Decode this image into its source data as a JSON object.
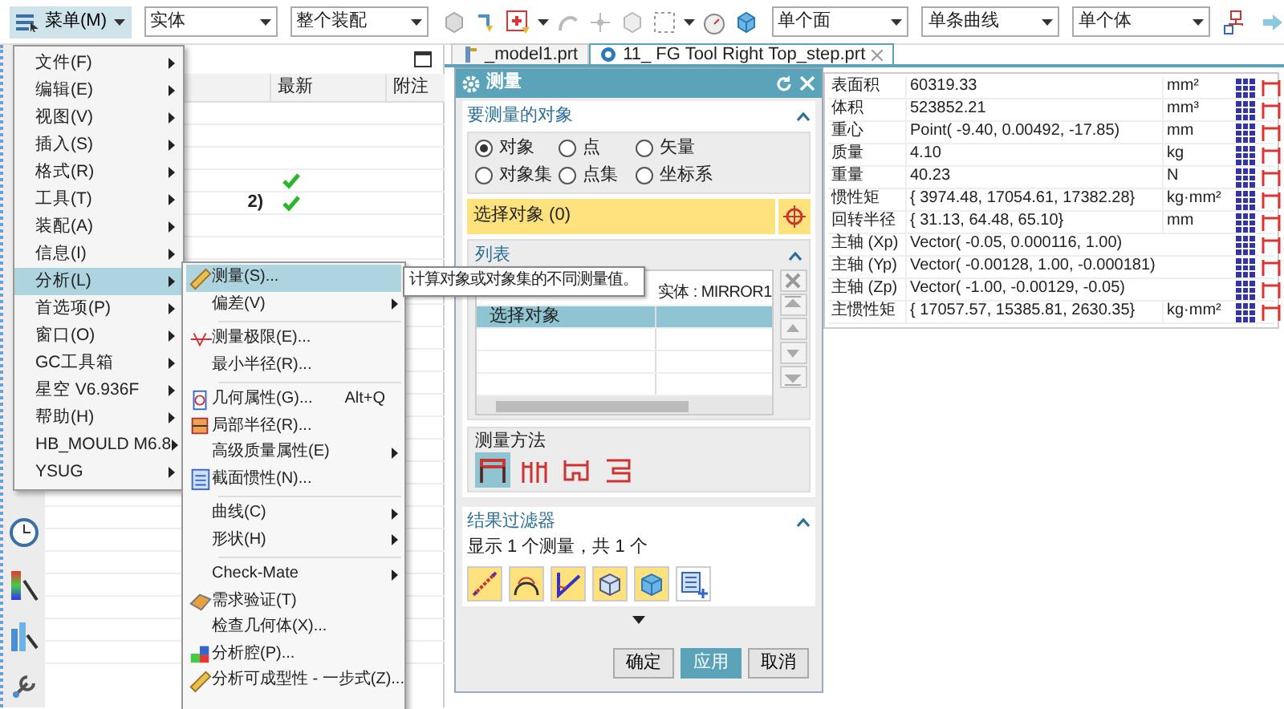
{
  "toolbar": {
    "menu_button": "菜单(M)",
    "selectors": [
      {
        "value": "实体"
      },
      {
        "value": "整个装配"
      },
      {
        "value": "单个面"
      },
      {
        "value": "单条曲线"
      },
      {
        "value": "单个体"
      }
    ]
  },
  "tabs": [
    {
      "label": "_model1.prt",
      "selected": false
    },
    {
      "label": "11_ FG Tool Right Top_step.prt",
      "selected": true
    }
  ],
  "part_navigator": {
    "columns": [
      "最新",
      "附注"
    ],
    "rows": [
      {
        "latest": true
      },
      {
        "name": "2)",
        "latest": true
      }
    ]
  },
  "main_menu": [
    {
      "label": "文件(F)",
      "submenu": true,
      "selected": false
    },
    {
      "label": "编辑(E)",
      "submenu": true,
      "selected": false
    },
    {
      "label": "视图(V)",
      "submenu": true,
      "selected": false
    },
    {
      "label": "插入(S)",
      "submenu": true,
      "selected": false
    },
    {
      "label": "格式(R)",
      "submenu": true,
      "selected": false
    },
    {
      "label": "工具(T)",
      "submenu": true,
      "selected": false
    },
    {
      "label": "装配(A)",
      "submenu": true,
      "selected": false
    },
    {
      "label": "信息(I)",
      "submenu": true,
      "selected": false
    },
    {
      "label": "分析(L)",
      "submenu": true,
      "selected": true
    },
    {
      "label": "首选项(P)",
      "submenu": true,
      "selected": false
    },
    {
      "label": "窗口(O)",
      "submenu": true,
      "selected": false
    },
    {
      "label": "GC工具箱",
      "submenu": true,
      "selected": false
    },
    {
      "label": "星空 V6.936F",
      "submenu": true,
      "selected": false
    },
    {
      "label": "帮助(H)",
      "submenu": true,
      "selected": false
    },
    {
      "label": "HB_MOULD M6.8",
      "submenu": true,
      "selected": false
    },
    {
      "label": "YSUG",
      "submenu": true,
      "selected": false
    }
  ],
  "analysis_menu": [
    {
      "kind": "item",
      "label": "测量(S)...",
      "icon": true,
      "submenu": false,
      "selected": true
    },
    {
      "kind": "item",
      "label": "偏差(V)",
      "icon": false,
      "submenu": true,
      "selected": false
    },
    {
      "kind": "separator"
    },
    {
      "kind": "item",
      "label": "测量极限(E)...",
      "icon": true,
      "submenu": false,
      "selected": false
    },
    {
      "kind": "item",
      "label": "最小半径(R)...",
      "icon": false,
      "submenu": false,
      "selected": false
    },
    {
      "kind": "separator"
    },
    {
      "kind": "item",
      "label": "几何属性(G)...",
      "shortcut": "Alt+Q",
      "icon": true,
      "submenu": false,
      "selected": false
    },
    {
      "kind": "item",
      "label": "局部半径(R)...",
      "icon": true,
      "submenu": false,
      "selected": false
    },
    {
      "kind": "item",
      "label": "高级质量属性(E)",
      "icon": false,
      "submenu": true,
      "selected": false
    },
    {
      "kind": "item",
      "label": "截面惯性(N)...",
      "icon": true,
      "submenu": false,
      "selected": false
    },
    {
      "kind": "separator"
    },
    {
      "kind": "item",
      "label": "曲线(C)",
      "icon": false,
      "submenu": true,
      "selected": false
    },
    {
      "kind": "item",
      "label": "形状(H)",
      "icon": false,
      "submenu": true,
      "selected": false
    },
    {
      "kind": "separator"
    },
    {
      "kind": "item",
      "label": "Check-Mate",
      "icon": false,
      "submenu": true,
      "selected": false
    },
    {
      "kind": "item",
      "label": "需求验证(T)",
      "icon": true,
      "submenu": false,
      "selected": false
    },
    {
      "kind": "item",
      "label": "检查几何体(X)...",
      "icon": false,
      "submenu": false,
      "selected": false
    },
    {
      "kind": "item",
      "label": "分析腔(P)...",
      "icon": true,
      "submenu": false,
      "selected": false
    },
    {
      "kind": "item",
      "label": "分析可成型性 - 一步式(Z)...",
      "icon": true,
      "submenu": false,
      "selected": false
    }
  ],
  "tooltip": "计算对象或对象集的不同测量值。",
  "measure_dialog": {
    "title": "测量",
    "objects_section": {
      "title": "要测量的对象",
      "expanded": true,
      "types": [
        {
          "label": "对象",
          "selected": true
        },
        {
          "label": "点",
          "selected": false
        },
        {
          "label": "矢量",
          "selected": false
        },
        {
          "label": "对象集",
          "selected": false
        },
        {
          "label": "点集",
          "selected": false
        },
        {
          "label": "坐标系",
          "selected": false
        }
      ],
      "select_row": "选择对象 (0)",
      "list": {
        "title": "列表",
        "expanded": true,
        "header": "实体 : MIRROR1",
        "rows": [
          {
            "label": "选择对象",
            "selected": true
          }
        ]
      },
      "method": {
        "title": "测量方法",
        "options": [
          {
            "selected": true
          },
          {
            "selected": false
          },
          {
            "selected": false
          },
          {
            "selected": false
          }
        ]
      }
    },
    "result_filter": {
      "title": "结果过滤器",
      "expanded": true,
      "summary": "显示 1 个测量，共 1 个",
      "filters": [
        {
          "on": true
        },
        {
          "on": true
        },
        {
          "on": true
        },
        {
          "on": true
        },
        {
          "on": true
        },
        {
          "on": false
        }
      ]
    },
    "buttons": [
      {
        "label": "确定",
        "kind": "default"
      },
      {
        "label": "应用",
        "kind": "primary"
      },
      {
        "label": "取消",
        "kind": "default"
      }
    ]
  },
  "results": [
    {
      "name": "表面积",
      "value": "60319.33",
      "unit": "mm²"
    },
    {
      "name": "体积",
      "value": "523852.21",
      "unit": "mm³"
    },
    {
      "name": "重心",
      "value": "Point( -9.40, 0.00492, -17.85)",
      "unit": "mm"
    },
    {
      "name": "质量",
      "value": "4.10",
      "unit": "kg"
    },
    {
      "name": "重量",
      "value": "40.23",
      "unit": "N"
    },
    {
      "name": "惯性矩",
      "value": "{ 3974.48, 17054.61, 17382.28}",
      "unit": "kg·mm²"
    },
    {
      "name": "回转半径",
      "value": "{ 31.13, 64.48, 65.10}",
      "unit": "mm"
    },
    {
      "name": "主轴 (Xp)",
      "value": "Vector( -0.05, 0.000116, 1.00)"
    },
    {
      "name": "主轴 (Yp)",
      "value": "Vector( -0.00128, 1.00, -0.000181)"
    },
    {
      "name": "主轴 (Zp)",
      "value": "Vector( -1.00, -0.00129, -0.05)"
    },
    {
      "name": "主惯性矩",
      "value": "{ 17057.57, 15385.81, 2630.35}",
      "unit": "kg·mm²"
    }
  ]
}
